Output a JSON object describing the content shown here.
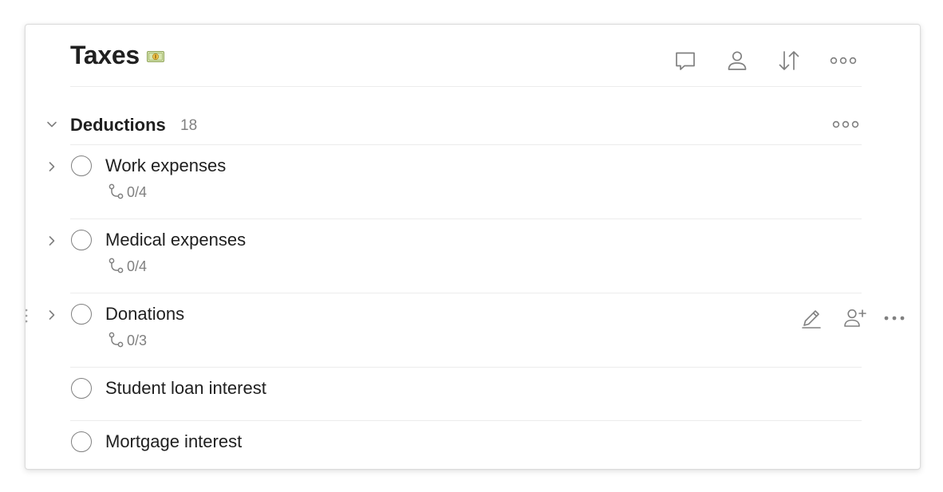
{
  "project": {
    "title": "Taxes",
    "emoji_icon": "money-banknote-icon"
  },
  "header_actions": [
    {
      "name": "comments",
      "icon": "comment-icon"
    },
    {
      "name": "share",
      "icon": "person-icon"
    },
    {
      "name": "sort",
      "icon": "sort-icon"
    },
    {
      "name": "more",
      "icon": "more-horizontal-icon"
    }
  ],
  "section": {
    "title": "Deductions",
    "count": "18"
  },
  "tasks": [
    {
      "name": "Work expenses",
      "has_subtasks": true,
      "subtasks": "0/4"
    },
    {
      "name": "Medical expenses",
      "has_subtasks": true,
      "subtasks": "0/4"
    },
    {
      "name": "Donations",
      "has_subtasks": true,
      "subtasks": "0/3"
    },
    {
      "name": "Student loan interest",
      "has_subtasks": false,
      "subtasks": ""
    },
    {
      "name": "Mortgage interest",
      "has_subtasks": false,
      "subtasks": ""
    }
  ],
  "hover_actions": [
    {
      "name": "edit",
      "icon": "pencil-icon"
    },
    {
      "name": "assign",
      "icon": "add-person-icon"
    },
    {
      "name": "more",
      "icon": "more-horizontal-icon"
    }
  ],
  "colors": {
    "text": "#202020",
    "muted": "#808080",
    "divider": "#ececec",
    "icon": "#808080"
  }
}
